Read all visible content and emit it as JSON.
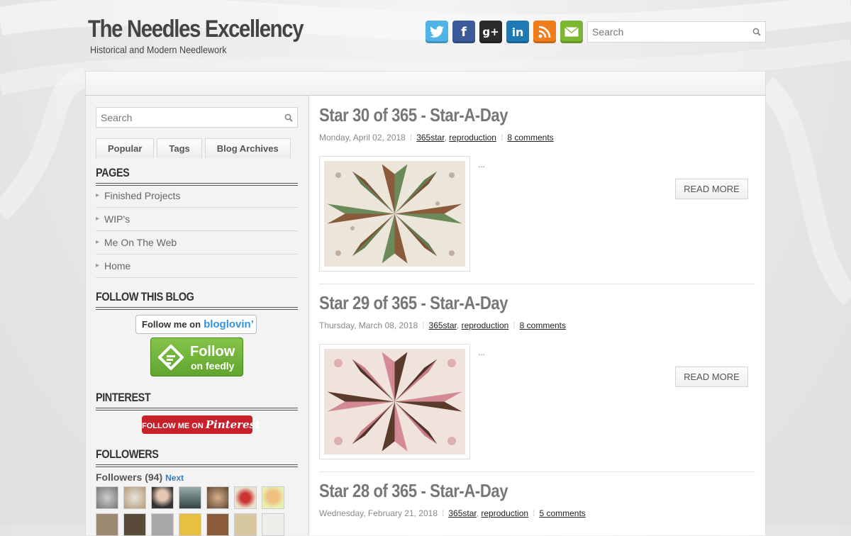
{
  "header": {
    "title": "The Needles Excellency",
    "description": "Historical and Modern Needlework",
    "social_icons": [
      "twitter-icon",
      "facebook-icon",
      "google-plus-icon",
      "linkedin-icon",
      "rss-icon",
      "email-icon"
    ],
    "search_placeholder": "Search"
  },
  "sidebar": {
    "search_placeholder": "Search",
    "tabs": [
      "Popular",
      "Tags",
      "Blog Archives"
    ],
    "pages_title": "PAGES",
    "pages": [
      "Finished Projects",
      "WIP's",
      "Me On The Web",
      "Home"
    ],
    "follow_title": "FOLLOW THIS BLOG",
    "bloglovin_prefix": "Follow me on",
    "bloglovin_brand": "bloglovin’",
    "feedly_big": "Follow",
    "feedly_small": "on feedly",
    "pinterest_title": "PINTEREST",
    "pinterest_prefix": "FOLLOW ME ON",
    "pinterest_brand": "Pinterest",
    "followers_title": "FOLLOWERS",
    "followers_label": "Followers (94)",
    "followers_next": "Next"
  },
  "posts": [
    {
      "title": "Star 30 of 365 - Star-A-Day",
      "date": "Monday, April 02, 2018",
      "labels": [
        "365star",
        "reproduction"
      ],
      "comments": "8 comments",
      "excerpt": "...",
      "read_more": "READ MORE"
    },
    {
      "title": "Star 29 of 365 - Star-A-Day",
      "date": "Thursday, March 08, 2018",
      "labels": [
        "365star",
        "reproduction"
      ],
      "comments": "8 comments",
      "excerpt": "...",
      "read_more": "READ MORE"
    },
    {
      "title": "Star 28 of 365 - Star-A-Day",
      "date": "Wednesday, February 21, 2018",
      "labels": [
        "365star",
        "reproduction"
      ],
      "comments": "5 comments"
    }
  ],
  "colors": {
    "twitter": "#4fb3e8",
    "facebook": "#3b5a9a",
    "linkedin": "#1e79b4",
    "rss": "#f07d1a",
    "email": "#7cb733",
    "pinterest": "#c8202b",
    "feedly": "#6cb037"
  }
}
